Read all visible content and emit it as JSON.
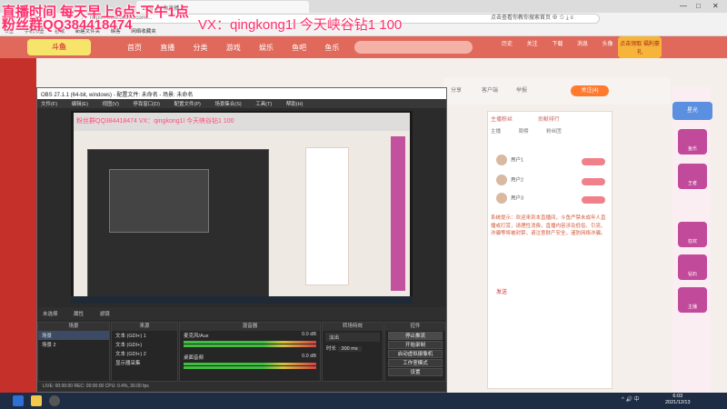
{
  "browser": {
    "tab_title": "公园 - 斗鱼直播 ...",
    "address": "https://www.douyu.com/...",
    "nav_glyphs": "‹ › ↻",
    "bookmarks": [
      "书签",
      "手机书签",
      "谷歌",
      "新建文件夹",
      "映客",
      "网络收藏夹"
    ],
    "right_tools": "点击查看你教你搜索首页 ⊕ ☆ ⤓ ≡",
    "window_controls": [
      "—",
      "□",
      "✕"
    ]
  },
  "overlay": {
    "line1": "直播时间 每天早上6点-下午1点",
    "line2": "粉丝群QQ384418474",
    "right": "VX：qingkong1l   今天峡谷钻1 100"
  },
  "douyu": {
    "logo": "斗鱼",
    "nav": [
      "首页",
      "直播",
      "分类",
      "游戏",
      "娱乐",
      "鱼吧",
      "鱼乐"
    ],
    "head_icons": [
      "历史",
      "关注",
      "下载",
      "消息",
      "头像"
    ],
    "promo": "点击领取 福利豪礼",
    "follow_button": "关注(4)",
    "room_icons": [
      "分享",
      "客户端",
      "举报"
    ],
    "chat_tabs": [
      "主播粉丝",
      "贡献排行"
    ],
    "chat_sub": [
      "主播",
      "周榜",
      "粉丝团"
    ],
    "chat_users": [
      "用户1",
      "用户2",
      "用户3"
    ],
    "gift_tag": "赠送",
    "chat_message": "系统提示：欢迎来到本直播间，斗鱼严禁未成年人直播或打赏，请理性消费。直播内容涉及低俗、引流、诈骗等将被封禁，请注意财产安全，谨防网络诈骗。",
    "chat_input": "发送",
    "side_top": "星光",
    "side_cards": [
      "鱼乐",
      "王者",
      "狂欢",
      "钻石",
      "主播"
    ]
  },
  "obs": {
    "title": "OBS 27.1.1 (64-bit, windows) - 配置文件: 未命名 - 场景: 未命名",
    "menu": [
      "文件(F)",
      "编辑(E)",
      "视图(V)",
      "停靠窗口(D)",
      "配置文件(P)",
      "场景集合(S)",
      "工具(T)",
      "帮助(H)"
    ],
    "inner_overlay": "粉丝群QQ384418474   VX：qingkong1l   今天峡谷钻1 100",
    "status_line": [
      "未选择",
      "属性",
      "滤镜"
    ],
    "docks": {
      "scenes": {
        "title": "场景",
        "items": [
          "场景",
          "场景 2"
        ]
      },
      "sources": {
        "title": "来源",
        "items": [
          "文本 (GDI+) 1",
          "文本 (GDI+)",
          "文本 (GDI+) 2",
          "显示器采集"
        ]
      },
      "mixer": {
        "title": "混音器",
        "channels": [
          "麦克风/Aux",
          "桌面音频"
        ],
        "level": "0.0 dB"
      },
      "transitions": {
        "title": "转场特效",
        "type": "淡出",
        "duration_label": "时长",
        "duration": "300 ms"
      },
      "controls": {
        "title": "控件",
        "buttons": [
          "停止推流",
          "开始录制",
          "启动虚拟摄像机",
          "工作室模式",
          "设置",
          "退出"
        ]
      }
    },
    "bottom": "LIVE: 00:00:00   REC: 00:00:00   CPU: 0.4%, 30.00 fps"
  },
  "taskbar": {
    "tray": "^ 🔊 中",
    "time": "6:03",
    "date": "2021/12/13"
  }
}
